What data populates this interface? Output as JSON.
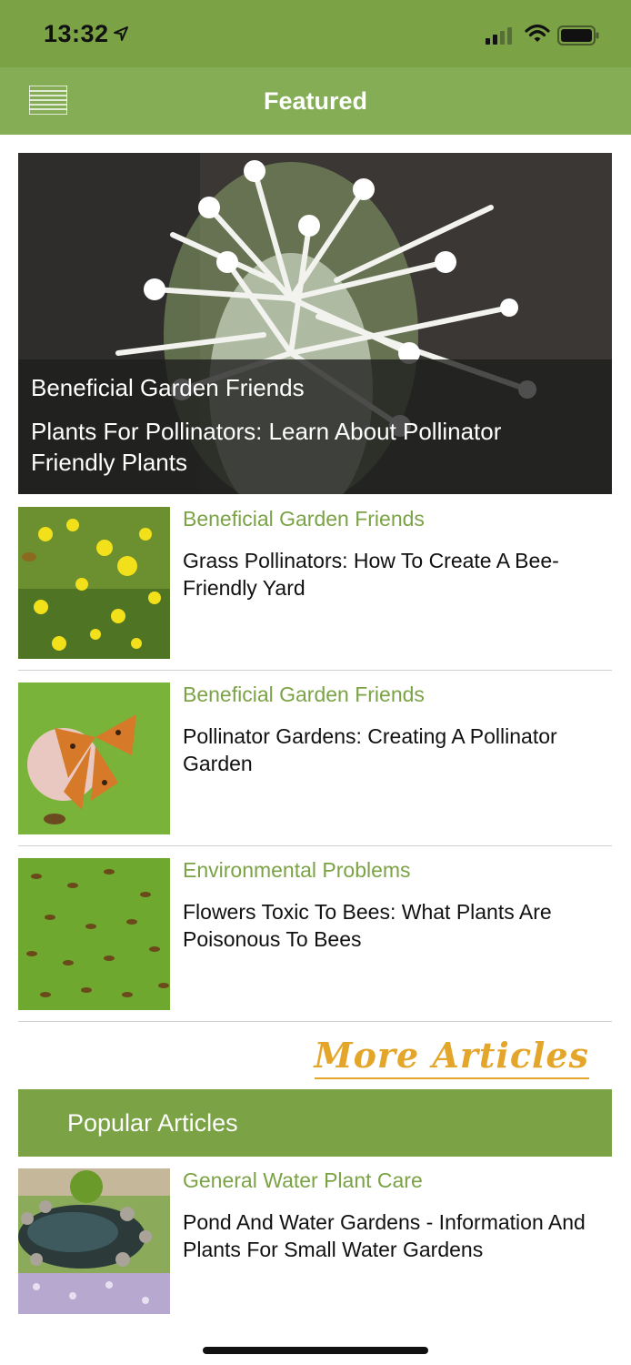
{
  "status_bar": {
    "time": "13:32"
  },
  "nav": {
    "title": "Featured"
  },
  "hero": {
    "category": "Beneficial Garden Friends",
    "title": "Plants For Pollinators: Learn About Pollinator Friendly Plants"
  },
  "articles": [
    {
      "category": "Beneficial Garden Friends",
      "title": "Grass Pollinators: How To Create A Bee-Friendly Yard"
    },
    {
      "category": "Beneficial Garden Friends",
      "title": "Pollinator Gardens: Creating A Pollinator Garden"
    },
    {
      "category": "Environmental Problems",
      "title": "Flowers Toxic To Bees: What Plants Are Poisonous To Bees"
    }
  ],
  "more_articles": "More Articles",
  "popular": {
    "header": "Popular Articles",
    "articles": [
      {
        "category": "General Water Plant Care",
        "title": "Pond And Water Gardens - Information And Plants For Small Water Gardens"
      }
    ]
  },
  "colors": {
    "brand_green": "#7ba345",
    "nav_green": "#85ad55",
    "accent_gold": "#e3a62a"
  },
  "icons": {
    "menu": "menu-icon",
    "location": "location-arrow-icon",
    "signal": "cellular-signal-icon",
    "wifi": "wifi-icon",
    "battery": "battery-icon"
  }
}
